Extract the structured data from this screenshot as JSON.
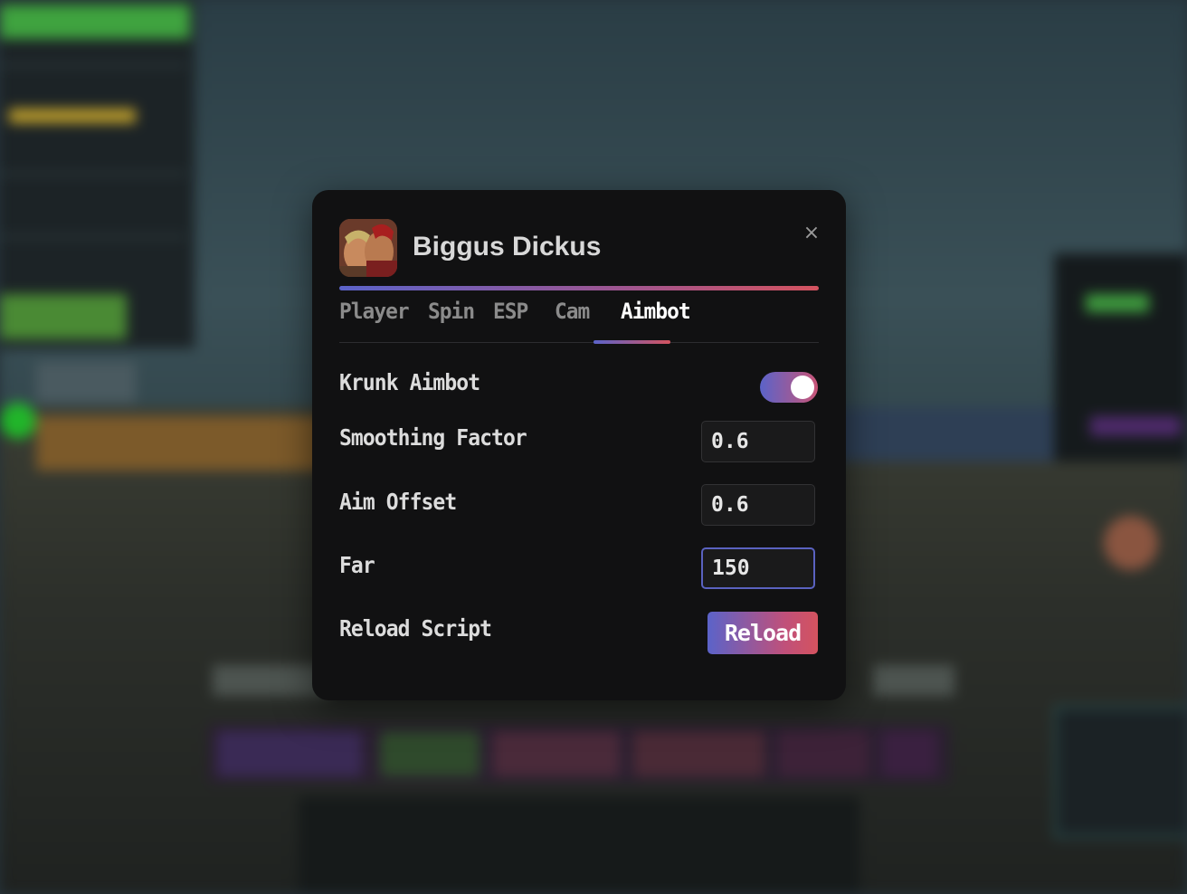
{
  "app": {
    "title": "Biggus Dickus",
    "close_glyph": "×"
  },
  "tabs": [
    {
      "label": "Player"
    },
    {
      "label": "Spin"
    },
    {
      "label": "ESP"
    },
    {
      "label": "Cam"
    },
    {
      "label": "Aimbot",
      "active": true
    }
  ],
  "settings": {
    "krunk_aimbot": {
      "label": "Krunk Aimbot",
      "enabled": true
    },
    "smoothing_factor": {
      "label": "Smoothing Factor",
      "value": "0.6"
    },
    "aim_offset": {
      "label": "Aim Offset",
      "value": "0.6"
    },
    "far": {
      "label": "Far",
      "value": "150"
    },
    "reload_script": {
      "label": "Reload Script",
      "button_label": "Reload"
    }
  },
  "colors": {
    "accent_start": "#5b63c9",
    "accent_end": "#d4535f",
    "panel_bg": "#111112"
  },
  "icons": {
    "avatar": "avatar-image",
    "close": "close-icon"
  }
}
